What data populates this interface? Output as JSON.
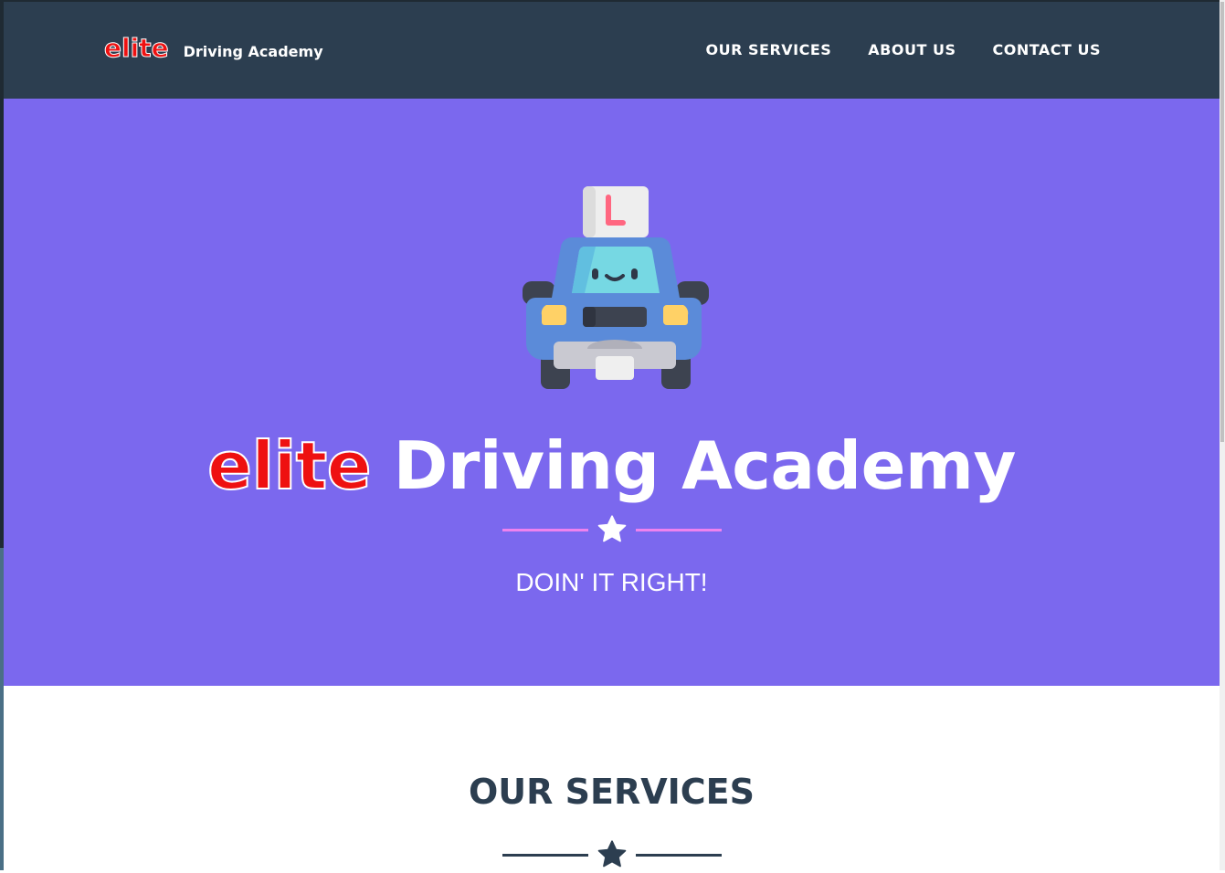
{
  "navbar": {
    "brand_logo": "elite",
    "brand_name": "Driving Academy",
    "links": [
      "OUR SERVICES",
      "ABOUT US",
      "CONTACT US"
    ]
  },
  "masthead": {
    "title_logo": "elite",
    "title_rest": "Driving Academy",
    "subtitle": "DOIN' IT RIGHT!",
    "icon": "learner-car-icon",
    "divider_icon": "star-icon"
  },
  "services": {
    "title": "OUR SERVICES",
    "divider_icon": "star-icon"
  },
  "colors": {
    "navbar_bg": "#2c3e50",
    "masthead_bg": "#7b68ee",
    "logo_red": "#ee1111",
    "hero_divider_line": "#ee82ee",
    "dark_text": "#2c3e50"
  }
}
